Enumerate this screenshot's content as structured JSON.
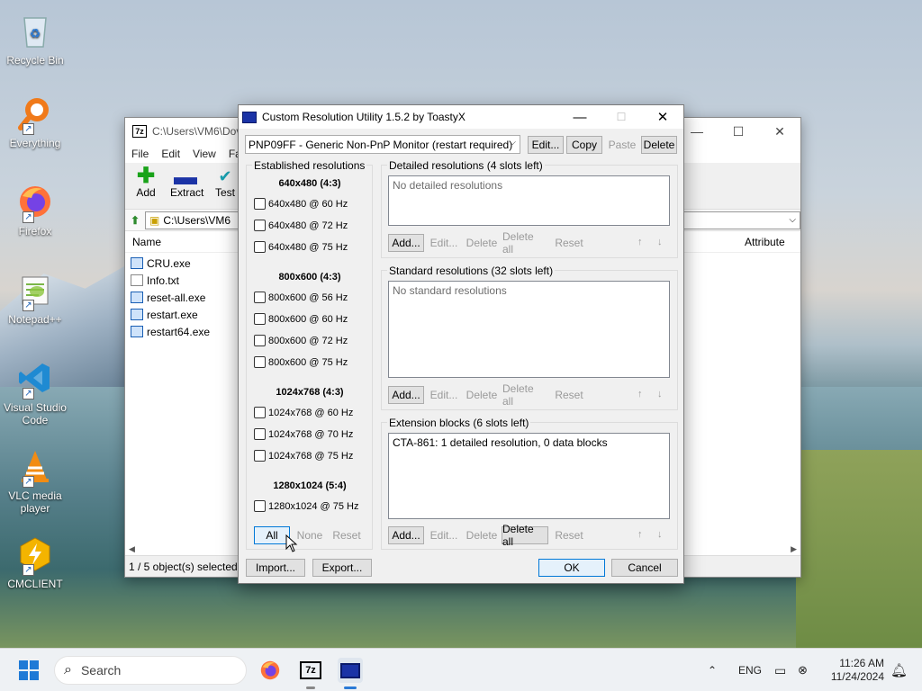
{
  "desktop": {
    "icons": [
      {
        "label": "Recycle Bin",
        "icon": "recycle-bin-icon"
      },
      {
        "label": "Everything",
        "icon": "everything-search-icon"
      },
      {
        "label": "Firefox",
        "icon": "firefox-icon"
      },
      {
        "label": "Notepad++",
        "icon": "notepad-plus-plus-icon"
      },
      {
        "label": "Visual Studio Code",
        "icon": "vscode-icon"
      },
      {
        "label": "VLC media player",
        "icon": "vlc-icon"
      },
      {
        "label": "CMCLIENT",
        "icon": "cmclient-icon"
      }
    ]
  },
  "explorer": {
    "title": "C:\\Users\\VM6\\Dov",
    "menu": [
      "File",
      "Edit",
      "View",
      "Fa"
    ],
    "tools": [
      {
        "label": "Add"
      },
      {
        "label": "Extract"
      },
      {
        "label": "Test"
      }
    ],
    "address": "C:\\Users\\VM6",
    "columns": {
      "name": "Name",
      "attributes": "Attribute"
    },
    "files": [
      "CRU.exe",
      "Info.txt",
      "reset-all.exe",
      "restart.exe",
      "restart64.exe"
    ],
    "status": "1 / 5 object(s) selected"
  },
  "dialog": {
    "title": "Custom Resolution Utility 1.5.2 by ToastyX",
    "monitor": "PNP09FF - Generic Non-PnP Monitor (restart required)",
    "top_buttons": {
      "edit": "Edit...",
      "copy": "Copy",
      "paste": "Paste",
      "delete": "Delete"
    },
    "established": {
      "label": "Established resolutions",
      "groups": [
        {
          "heading": "640x480 (4:3)",
          "items": [
            "640x480 @ 60 Hz",
            "640x480 @ 72 Hz",
            "640x480 @ 75 Hz"
          ]
        },
        {
          "heading": "800x600 (4:3)",
          "items": [
            "800x600 @ 56 Hz",
            "800x600 @ 60 Hz",
            "800x600 @ 72 Hz",
            "800x600 @ 75 Hz"
          ]
        },
        {
          "heading": "1024x768 (4:3)",
          "items": [
            "1024x768 @ 60 Hz",
            "1024x768 @ 70 Hz",
            "1024x768 @ 75 Hz"
          ]
        },
        {
          "heading": "1280x1024 (5:4)",
          "items": [
            "1280x1024 @ 75 Hz"
          ]
        }
      ],
      "buttons": {
        "all": "All",
        "none": "None",
        "reset": "Reset"
      }
    },
    "detailed": {
      "label": "Detailed resolutions (4 slots left)",
      "empty": "No detailed resolutions"
    },
    "standard": {
      "label": "Standard resolutions (32 slots left)",
      "empty": "No standard resolutions"
    },
    "extension": {
      "label": "Extension blocks (6 slots left)",
      "item": "CTA-861: 1 detailed resolution, 0 data blocks"
    },
    "row_buttons": {
      "add": "Add...",
      "edit": "Edit...",
      "delete": "Delete",
      "delete_all": "Delete all",
      "reset": "Reset",
      "up": "↑",
      "down": "↓"
    },
    "bottom": {
      "import": "Import...",
      "export": "Export...",
      "ok": "OK",
      "cancel": "Cancel"
    }
  },
  "taskbar": {
    "search_placeholder": "Search",
    "language": "ENG",
    "time": "11:26 AM",
    "date": "11/24/2024"
  }
}
